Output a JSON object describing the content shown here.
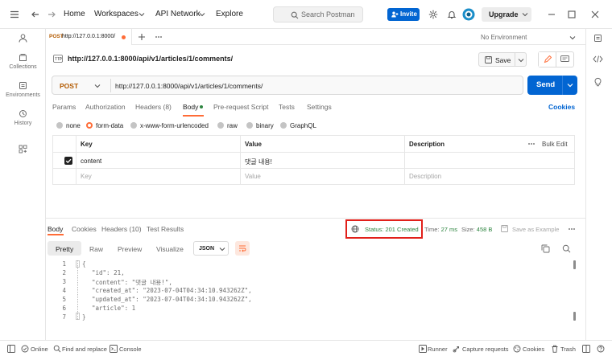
{
  "app": {
    "nav_home": "Home",
    "nav_workspaces": "Workspaces",
    "nav_api_network": "API Network",
    "nav_explore": "Explore",
    "search_placeholder": "Search Postman",
    "invite_label": "Invite",
    "upgrade_label": "Upgrade"
  },
  "sidebar": {
    "items": [
      {
        "label": "",
        "icon": "user-icon"
      },
      {
        "label": "Collections",
        "icon": "collections-icon"
      },
      {
        "label": "Environments",
        "icon": "environments-icon"
      },
      {
        "label": "History",
        "icon": "history-icon"
      },
      {
        "label": "",
        "icon": "apps-grid-icon"
      }
    ]
  },
  "tab": {
    "method": "POST",
    "url": "http://127.0.0.1:8000/"
  },
  "environment": "No Environment",
  "request": {
    "name": "http://127.0.0.1:8000/api/v1/articles/1/comments/",
    "method": "POST",
    "url": "http://127.0.0.1:8000/api/v1/articles/1/comments/",
    "save_label": "Save",
    "send_label": "Send",
    "tabs": [
      "Params",
      "Authorization",
      "Headers (8)",
      "Body",
      "Pre-request Script",
      "Tests",
      "Settings"
    ],
    "cookies_label": "Cookies",
    "body_types": [
      "none",
      "form-data",
      "x-www-form-urlencoded",
      "raw",
      "binary",
      "GraphQL"
    ]
  },
  "params_table": {
    "headers": [
      "Key",
      "Value",
      "Description"
    ],
    "bulk_edit": "Bulk Edit",
    "rows": [
      {
        "key": "content",
        "value": "댓글 내용!",
        "description": ""
      }
    ],
    "placeholder": {
      "key": "Key",
      "value": "Value",
      "description": "Description"
    }
  },
  "response": {
    "tabs": [
      "Body",
      "Cookies",
      "Headers (10)",
      "Test Results"
    ],
    "status_label": "Status:",
    "status_value": "201 Created",
    "time_label": "Time:",
    "time_value": "27 ms",
    "size_label": "Size:",
    "size_value": "458 B",
    "save_example": "Save as Example",
    "formats": [
      "Pretty",
      "Raw",
      "Preview",
      "Visualize"
    ],
    "language": "JSON",
    "lines": [
      {
        "n": "1",
        "text": "{"
      },
      {
        "n": "2",
        "text": "\"id\": 21,"
      },
      {
        "n": "3",
        "text": "\"content\": \"댓글 내용!\","
      },
      {
        "n": "4",
        "text": "\"created_at\": \"2023-07-04T04:34:10.943262Z\","
      },
      {
        "n": "5",
        "text": "\"updated_at\": \"2023-07-04T04:34:10.943262Z\","
      },
      {
        "n": "6",
        "text": "\"article\": 1"
      },
      {
        "n": "7",
        "text": "}"
      }
    ]
  },
  "footer": {
    "online": "Online",
    "find_replace": "Find and replace",
    "console": "Console",
    "runner": "Runner",
    "capture": "Capture requests",
    "cookies": "Cookies",
    "trash": "Trash"
  },
  "colors": {
    "accent": "#ff6c37",
    "primary": "#0265d2",
    "success": "#2e8540",
    "method_post": "#b35a00",
    "highlight_box": "#e1201a"
  }
}
